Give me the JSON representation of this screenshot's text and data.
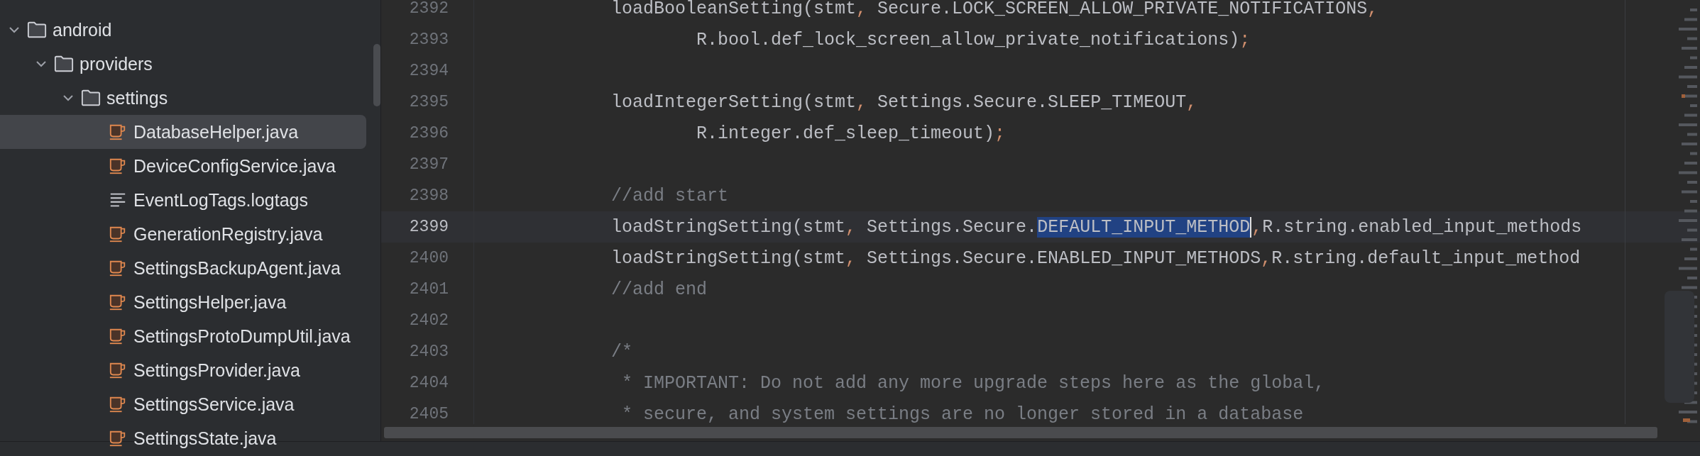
{
  "project_tree": {
    "items": [
      {
        "name": "android",
        "kind": "folder",
        "expanded": true,
        "selected": false,
        "children": [
          {
            "name": "providers",
            "kind": "folder",
            "expanded": true,
            "selected": false,
            "children": [
              {
                "name": "settings",
                "kind": "folder",
                "expanded": true,
                "selected": false,
                "children": [
                  {
                    "name": "DatabaseHelper.java",
                    "kind": "java",
                    "selected": true
                  },
                  {
                    "name": "DeviceConfigService.java",
                    "kind": "java",
                    "selected": false
                  },
                  {
                    "name": "EventLogTags.logtags",
                    "kind": "text",
                    "selected": false
                  },
                  {
                    "name": "GenerationRegistry.java",
                    "kind": "java",
                    "selected": false
                  },
                  {
                    "name": "SettingsBackupAgent.java",
                    "kind": "java",
                    "selected": false
                  },
                  {
                    "name": "SettingsHelper.java",
                    "kind": "java",
                    "selected": false
                  },
                  {
                    "name": "SettingsProtoDumpUtil.java",
                    "kind": "java",
                    "selected": false
                  },
                  {
                    "name": "SettingsProvider.java",
                    "kind": "java",
                    "selected": false
                  },
                  {
                    "name": "SettingsService.java",
                    "kind": "java",
                    "selected": false
                  },
                  {
                    "name": "SettingsState.java",
                    "kind": "java",
                    "selected": false
                  }
                ]
              }
            ]
          }
        ]
      }
    ]
  },
  "editor": {
    "lines": [
      {
        "number": "2392",
        "current": false,
        "segments": [
          {
            "kind": "code",
            "text": "loadBooleanSetting(stmt"
          },
          {
            "kind": "punct",
            "text": ","
          },
          {
            "kind": "code",
            "text": " Secure.LOCK_SCREEN_ALLOW_PRIVATE_NOTIFICATIONS"
          },
          {
            "kind": "punct",
            "text": ","
          }
        ]
      },
      {
        "number": "2393",
        "current": false,
        "segments": [
          {
            "kind": "code",
            "text": "        R.bool.def_lock_screen_allow_private_notifications)"
          },
          {
            "kind": "punct",
            "text": ";"
          }
        ]
      },
      {
        "number": "2394",
        "current": false
      },
      {
        "number": "2395",
        "current": false,
        "segments": [
          {
            "kind": "code",
            "text": "loadIntegerSetting(stmt"
          },
          {
            "kind": "punct",
            "text": ","
          },
          {
            "kind": "code",
            "text": " Settings.Secure.SLEEP_TIMEOUT"
          },
          {
            "kind": "punct",
            "text": ","
          }
        ]
      },
      {
        "number": "2396",
        "current": false,
        "segments": [
          {
            "kind": "code",
            "text": "        R.integer.def_sleep_timeout)"
          },
          {
            "kind": "punct",
            "text": ";"
          }
        ]
      },
      {
        "number": "2397",
        "current": false
      },
      {
        "number": "2398",
        "current": false,
        "segments": [
          {
            "kind": "comment",
            "text": "//add start"
          }
        ]
      },
      {
        "number": "2399",
        "current": true,
        "segments": [
          {
            "kind": "code",
            "text": "loadStringSetting(stmt"
          },
          {
            "kind": "punct",
            "text": ","
          },
          {
            "kind": "code",
            "text": " Settings.Secure."
          },
          {
            "kind": "selected",
            "text": "DEFAULT_INPUT_METHOD"
          },
          {
            "kind": "punct",
            "text": ","
          },
          {
            "kind": "code",
            "text": "R.string.enabled_input_methods"
          }
        ]
      },
      {
        "number": "2400",
        "current": false,
        "segments": [
          {
            "kind": "code",
            "text": "loadStringSetting(stmt"
          },
          {
            "kind": "punct",
            "text": ","
          },
          {
            "kind": "code",
            "text": " Settings.Secure.ENABLED_INPUT_METHODS"
          },
          {
            "kind": "punct",
            "text": ","
          },
          {
            "kind": "code",
            "text": "R.string.default_input_method"
          }
        ]
      },
      {
        "number": "2401",
        "current": false,
        "segments": [
          {
            "kind": "comment",
            "text": "//add end"
          }
        ]
      },
      {
        "number": "2402",
        "current": false
      },
      {
        "number": "2403",
        "current": false,
        "segments": [
          {
            "kind": "comment",
            "text": "/*"
          }
        ]
      },
      {
        "number": "2404",
        "current": false,
        "segments": [
          {
            "kind": "comment",
            "text": " * IMPORTANT: Do not add any more upgrade steps here as the global,"
          }
        ]
      },
      {
        "number": "2405",
        "current": false,
        "segments": [
          {
            "kind": "comment",
            "text": " * secure, and system settings are no longer stored in a database"
          }
        ]
      }
    ]
  }
}
